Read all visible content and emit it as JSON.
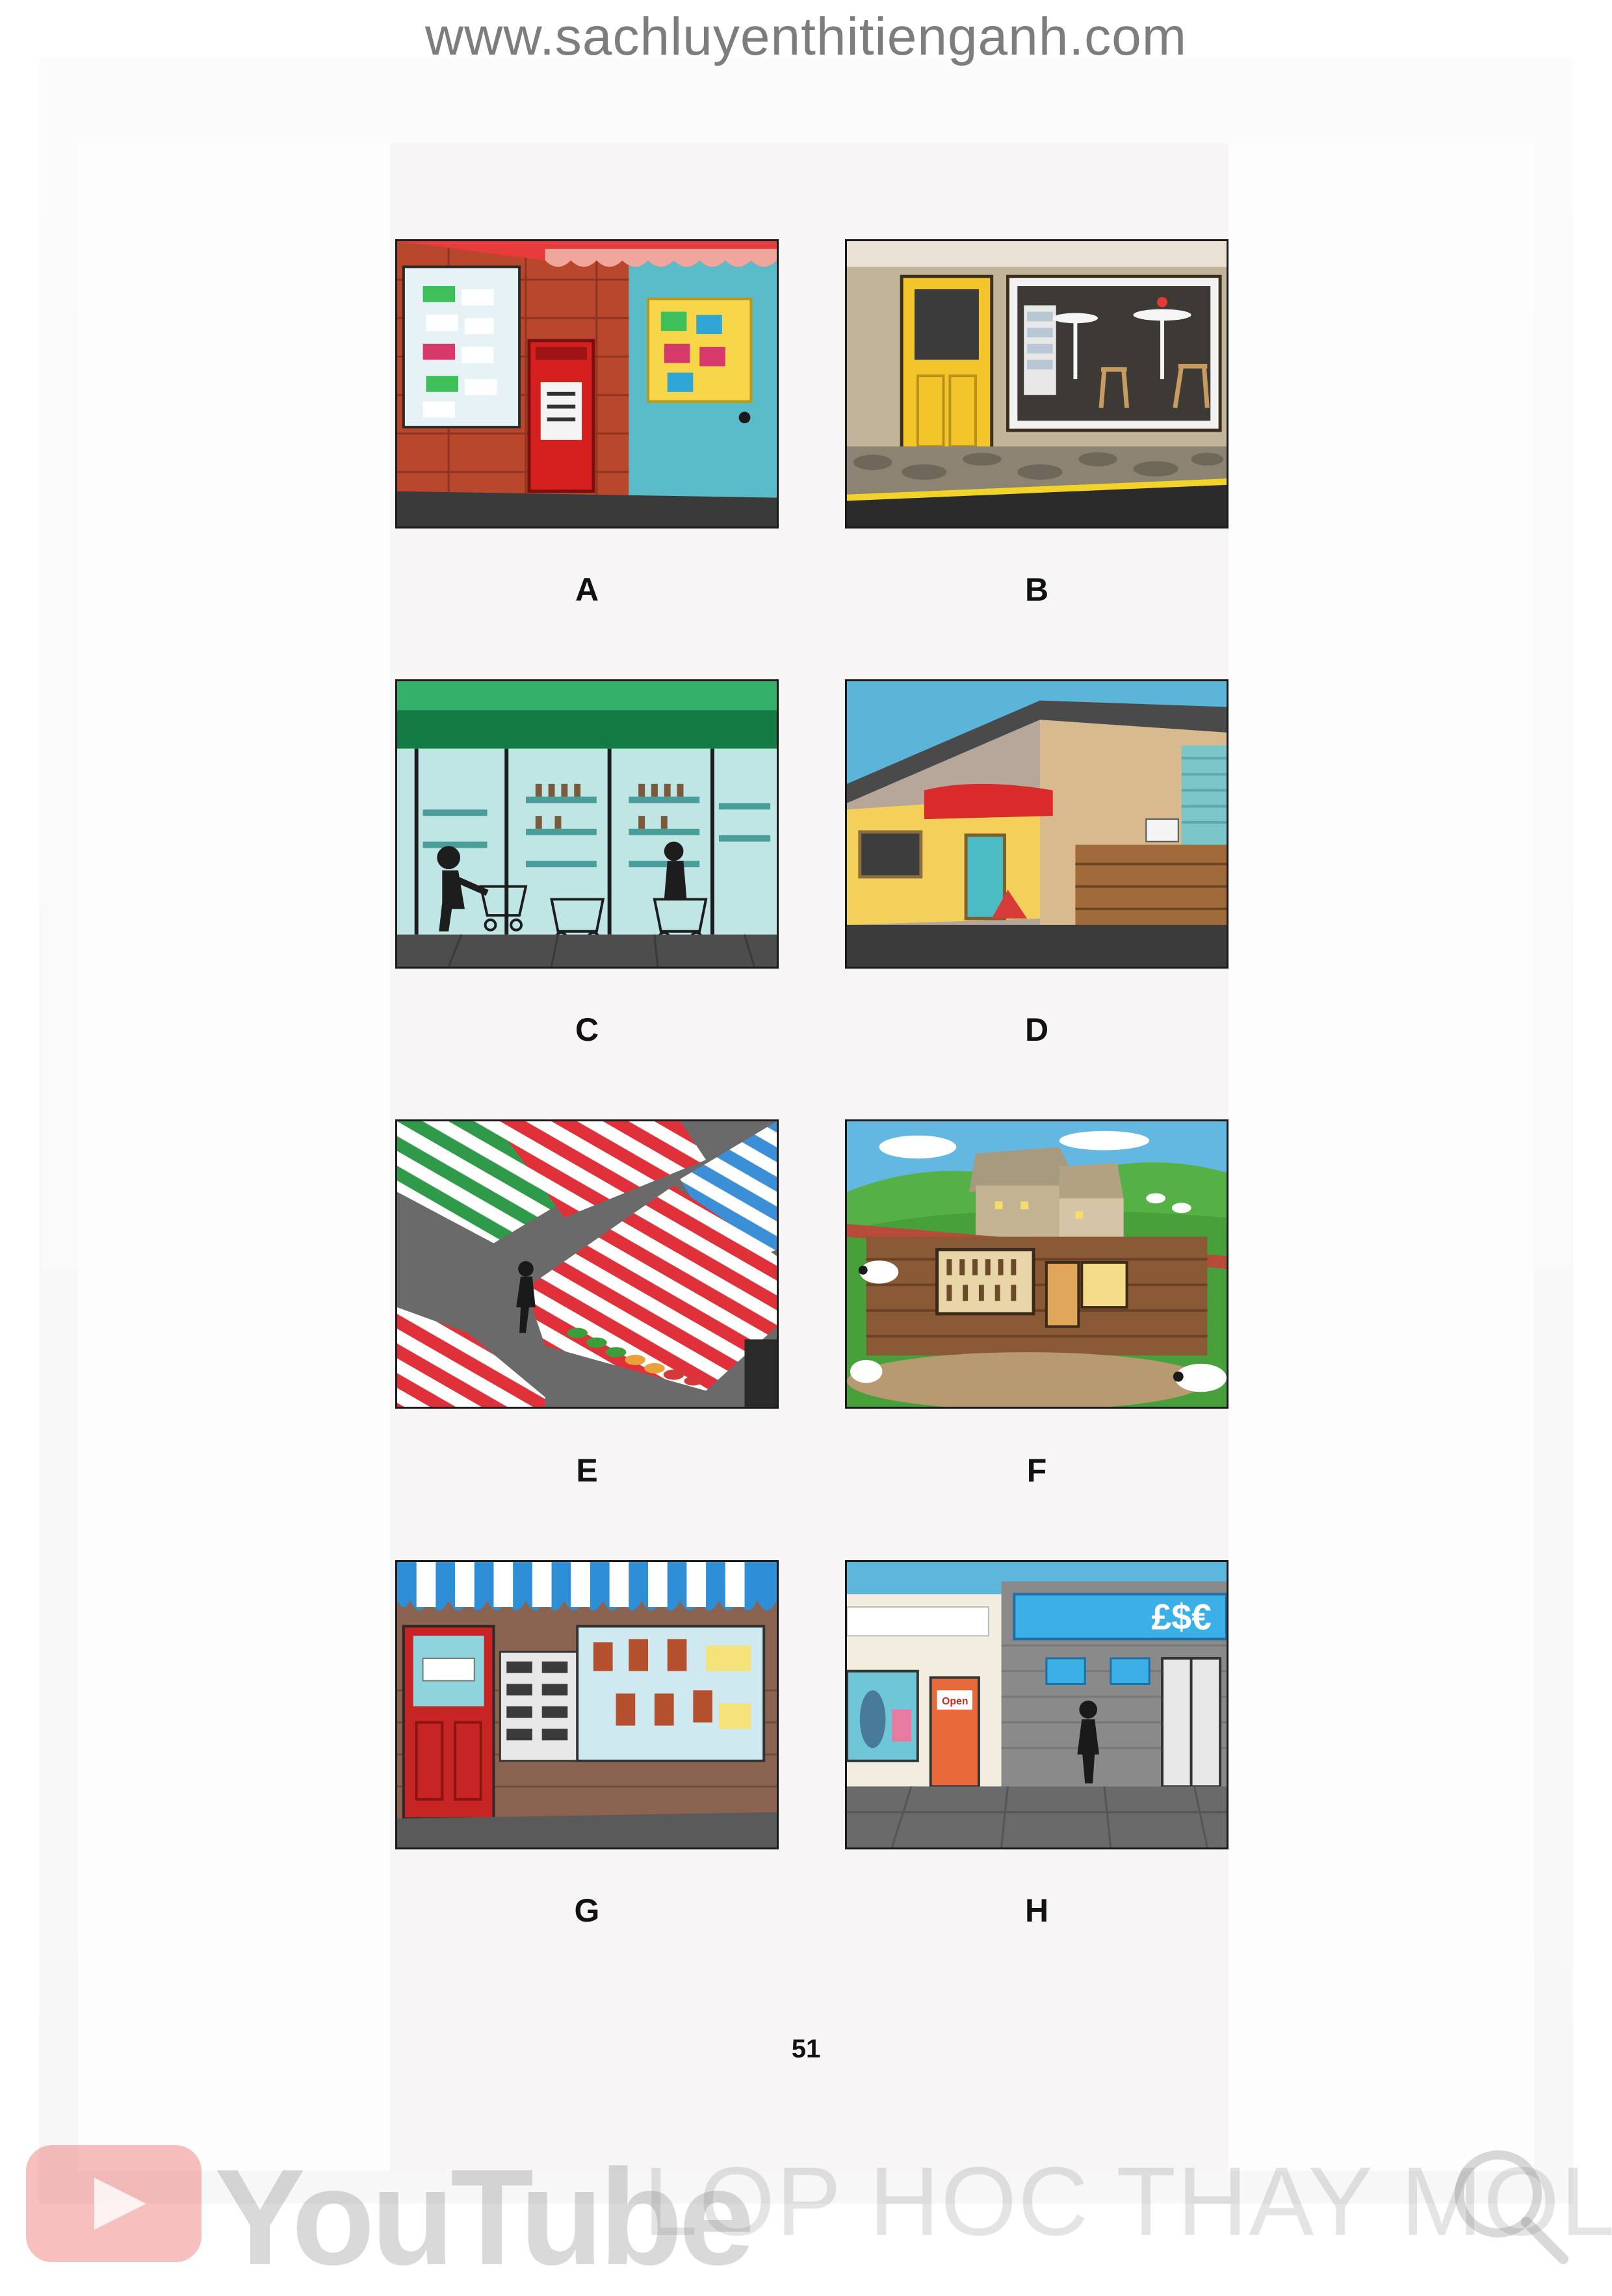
{
  "header": {
    "website": "www.sachluyenthitienganh.com"
  },
  "pictures": [
    {
      "id": "a",
      "label": "A",
      "icon": "post-office-shopfront"
    },
    {
      "id": "b",
      "label": "B",
      "icon": "cafe-shopfront"
    },
    {
      "id": "c",
      "label": "C",
      "icon": "supermarket-shopfront"
    },
    {
      "id": "d",
      "label": "D",
      "icon": "warehouse-building"
    },
    {
      "id": "e",
      "label": "E",
      "icon": "street-market-stalls"
    },
    {
      "id": "f",
      "label": "F",
      "icon": "farm-shop"
    },
    {
      "id": "g",
      "label": "G",
      "icon": "pharmacy-shopfront"
    },
    {
      "id": "h",
      "label": "H",
      "icon": "bank-exchange-office"
    }
  ],
  "panel_texts": {
    "open_sign": "Open",
    "currency_sign": "£$€"
  },
  "footer": {
    "page_number": "51"
  },
  "watermark": {
    "brand": "YouTube",
    "channel": "LOP HOC THAY MOL"
  },
  "colors": {
    "youtube_red": "#e52d27",
    "ink": "#111111"
  }
}
